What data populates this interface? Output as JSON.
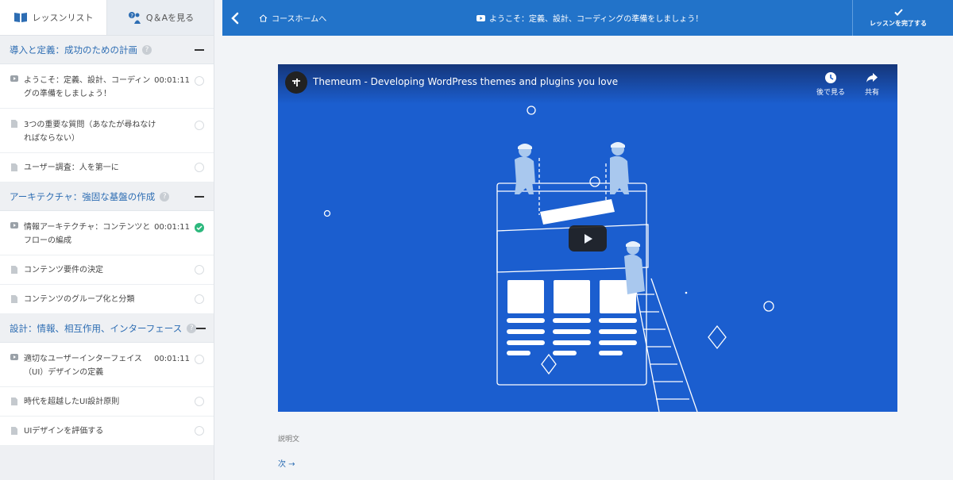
{
  "sidebar": {
    "tabs": {
      "lessons_label": "レッスンリスト",
      "qa_label": "Q＆Aを見る"
    },
    "topics": [
      {
        "title": "導入と定義：成功のための計画",
        "lessons": [
          {
            "title": "ようこそ：定義、設計、コーディングの準備をしましょう！",
            "duration": "00:01:11",
            "type": "video",
            "done": false
          },
          {
            "title": "3つの重要な質問（あなたが尋ねなければならない）",
            "duration": "",
            "type": "doc",
            "done": false
          },
          {
            "title": "ユーザー調査：人を第一に",
            "duration": "",
            "type": "doc",
            "done": false
          }
        ]
      },
      {
        "title": "アーキテクチャ：強固な基盤の作成",
        "lessons": [
          {
            "title": "情報アーキテクチャ：コンテンツとフローの編成",
            "duration": "00:01:11",
            "type": "video",
            "done": true
          },
          {
            "title": "コンテンツ要件の決定",
            "duration": "",
            "type": "doc",
            "done": false
          },
          {
            "title": "コンテンツのグループ化と分類",
            "duration": "",
            "type": "doc",
            "done": false
          }
        ]
      },
      {
        "title": "設計：情報、相互作用、インターフェース",
        "lessons": [
          {
            "title": "適切なユーザーインターフェイス（UI）デザインの定義",
            "duration": "00:01:11",
            "type": "video",
            "done": false
          },
          {
            "title": "時代を超越したUI設計原則",
            "duration": "",
            "type": "doc",
            "done": false
          },
          {
            "title": "UIデザインを評価する",
            "duration": "",
            "type": "doc",
            "done": false
          }
        ]
      }
    ]
  },
  "header": {
    "home_label": "コースホームへ",
    "lesson_title": "ようこそ：定義、設計、コーディングの準備をしましょう！",
    "complete_label": "レッスンを完了する"
  },
  "video": {
    "title": "Themeum - Developing WordPress themes and plugins you love",
    "watch_later": "後で見る",
    "share": "共有"
  },
  "main": {
    "description_label": "説明文",
    "next_label": "次 →"
  },
  "colors": {
    "header": "#2273c9",
    "video_bg": "#1b5ecf",
    "topic_title": "#2d6db3",
    "done": "#2db87d"
  }
}
